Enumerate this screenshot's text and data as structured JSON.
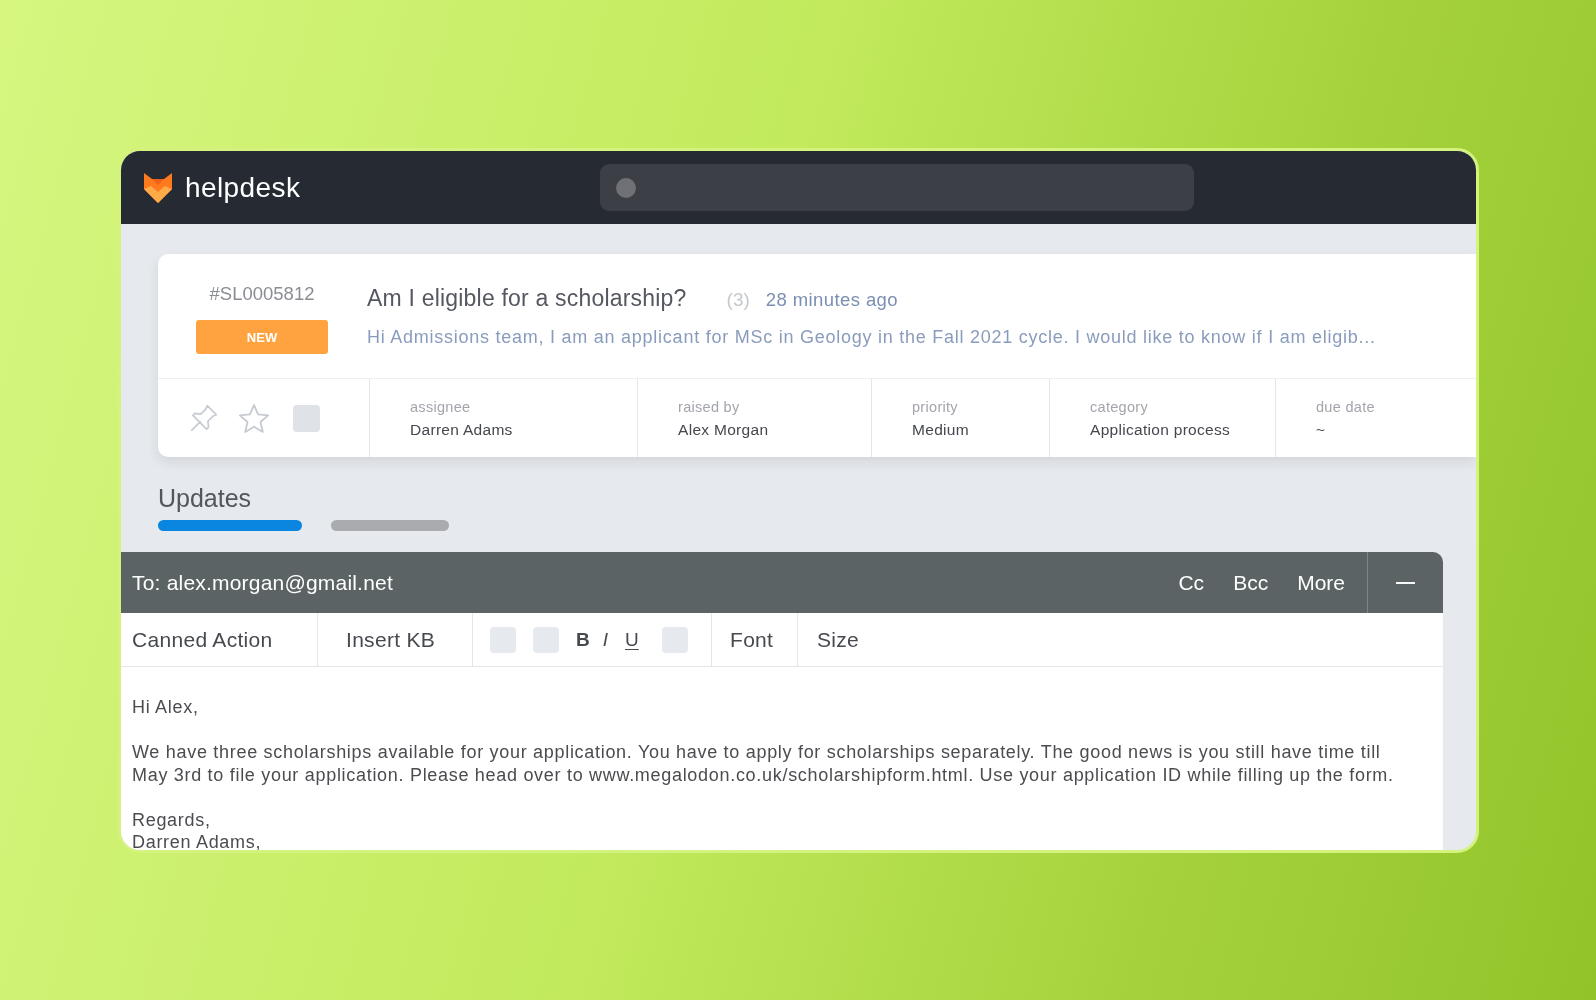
{
  "app": {
    "name": "helpdesk"
  },
  "ticket": {
    "id": "#SL0005812",
    "status": "NEW",
    "title": "Am I eligible for a scholarship?",
    "reply_count": "(3)",
    "time": "28 minutes ago",
    "preview": "Hi Admissions team, I am an applicant for MSc in Geology in the Fall 2021 cycle. I would like to know if I am eligib...",
    "pinned": false,
    "starred": false,
    "fields": [
      {
        "label": "assignee",
        "value": "Darren Adams"
      },
      {
        "label": "raised by",
        "value": "Alex Morgan"
      },
      {
        "label": "priority",
        "value": "Medium"
      },
      {
        "label": "category",
        "value": "Application process"
      },
      {
        "label": "due date",
        "value": "~"
      }
    ]
  },
  "tabs": [
    {
      "label": "Updates",
      "selected": true
    },
    {
      "selected": false
    }
  ],
  "composer": {
    "to": "To: alex.morgan@gmail.net",
    "actions": [
      "Cc",
      "Bcc",
      "More"
    ],
    "toolbar": [
      {
        "kind": "menu",
        "label": "Canned Action"
      },
      {
        "kind": "menu",
        "label": "Insert KB"
      },
      {
        "kind": "format",
        "items": [
          {
            "kind": "blank"
          },
          {
            "kind": "blank"
          },
          {
            "kind": "bold",
            "label": "B"
          },
          {
            "kind": "italic",
            "label": "I"
          },
          {
            "kind": "underline",
            "label": "U"
          },
          {
            "kind": "blank"
          }
        ]
      },
      {
        "kind": "menu",
        "label": "Font"
      },
      {
        "kind": "menu",
        "label": "Size"
      }
    ],
    "body": [
      [
        "Hi Alex,"
      ],
      [
        "We have three scholarships available for your application. You have to apply for scholarships separately. The good news is you still have time till",
        "May 3rd to file your application. Please head over to www.megalodon.co.uk/scholarshipform.html. Use your application ID while filling up the form."
      ],
      [
        "Regards,",
        "Darren Adams,"
      ]
    ]
  }
}
